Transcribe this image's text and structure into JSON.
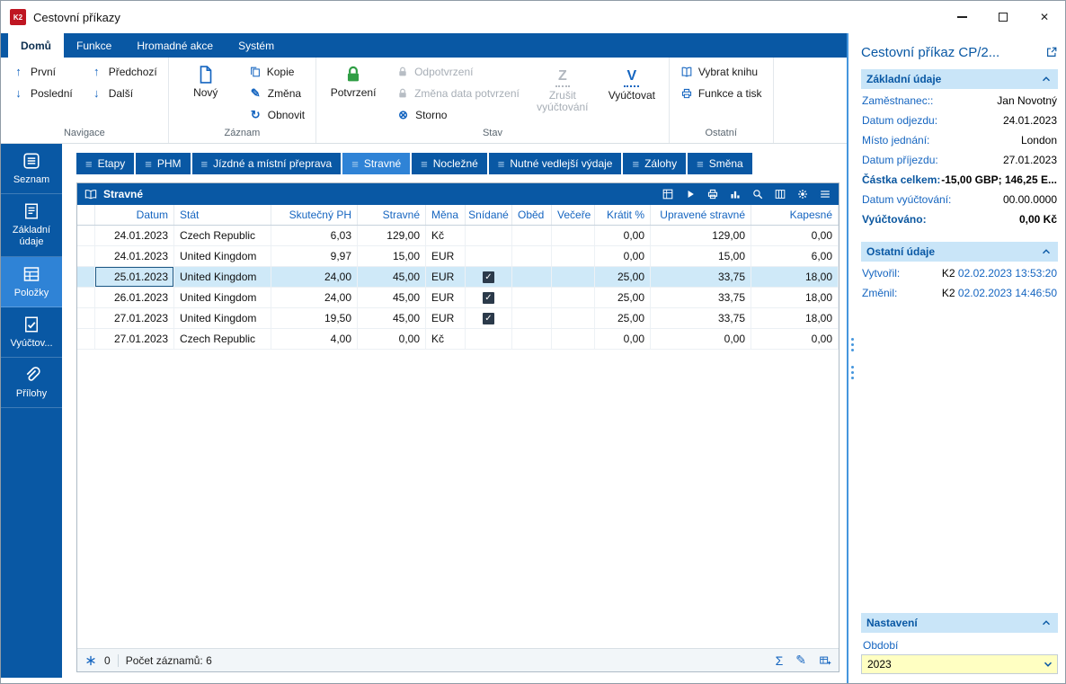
{
  "window": {
    "title": "Cestovní příkazy"
  },
  "colors": {
    "accent": "#0958a4",
    "accent_light": "#2f83d6",
    "selection": "#cfe9f8",
    "section_header_bg": "#c9e5f8",
    "combo_bg": "#ffffc2",
    "confirm_green": "#2f9e44",
    "label_blue": "#1565c0",
    "app_icon_red": "#bf1622"
  },
  "ribbon": {
    "tabs": [
      {
        "label": "Domů",
        "active": true
      },
      {
        "label": "Funkce",
        "active": false
      },
      {
        "label": "Hromadné akce",
        "active": false
      },
      {
        "label": "Systém",
        "active": false
      }
    ],
    "groups": [
      {
        "label": "Navigace"
      },
      {
        "label": "Záznam"
      },
      {
        "label": "Stav"
      },
      {
        "label": "Ostatní"
      }
    ],
    "buttons": {
      "prvni": "První",
      "posledni": "Poslední",
      "predchozi": "Předchozí",
      "dalsi": "Další",
      "novy": "Nový",
      "kopie": "Kopie",
      "zmena": "Změna",
      "obnovit": "Obnovit",
      "potvrzeni": "Potvrzení",
      "odpotvrzeni": "Odpotvrzení",
      "zmena_data_potvrzeni": "Změna data potvrzení",
      "storno": "Storno",
      "zrusit_vyuctovani": "Zrušit vyúčtování",
      "vyuctovat": "Vyúčtovat",
      "vybrat_knihu": "Vybrat knihu",
      "funkce_a_tisk": "Funkce a tisk"
    }
  },
  "sidebar": {
    "items": [
      {
        "label": "Seznam",
        "icon": "list-box-icon",
        "active": false
      },
      {
        "label": "Základní údaje",
        "icon": "form-icon",
        "active": false
      },
      {
        "label": "Položky",
        "icon": "items-grid-icon",
        "active": true
      },
      {
        "label": "Vyúčtov...",
        "icon": "receipt-check-icon",
        "active": false
      },
      {
        "label": "Přílohy",
        "icon": "paperclip-icon",
        "active": false
      }
    ]
  },
  "doc_tabs": {
    "items": [
      "Etapy",
      "PHM",
      "Jízdné a místní přeprava",
      "Stravné",
      "Nocležné",
      "Nutné vedlejší výdaje",
      "Zálohy",
      "Směna"
    ],
    "active": "Stravné"
  },
  "grid": {
    "title": "Stravné",
    "toolbar_icons": [
      "export-table-icon",
      "play-icon",
      "print-icon",
      "chart-icon",
      "search-icon",
      "columns-icon",
      "gear-icon",
      "menu-icon"
    ],
    "columns": [
      {
        "id": "rowsel",
        "label": "",
        "width": 20,
        "align": "left"
      },
      {
        "id": "datum",
        "label": "Datum",
        "width": 88,
        "align": "right"
      },
      {
        "id": "stat",
        "label": "Stát",
        "width": 108,
        "align": "left"
      },
      {
        "id": "skutecny_ph",
        "label": "Skutečný PH",
        "width": 96,
        "align": "right"
      },
      {
        "id": "stravne",
        "label": "Stravné",
        "width": 76,
        "align": "right"
      },
      {
        "id": "mena",
        "label": "Měna",
        "width": 44,
        "align": "left"
      },
      {
        "id": "snidane",
        "label": "Snídané",
        "width": 52,
        "align": "center",
        "type": "check"
      },
      {
        "id": "obed",
        "label": "Oběd",
        "width": 44,
        "align": "left"
      },
      {
        "id": "vecere",
        "label": "Večeře",
        "width": 48,
        "align": "left"
      },
      {
        "id": "kratit",
        "label": "Krátit %",
        "width": 62,
        "align": "right"
      },
      {
        "id": "upravene_stravne",
        "label": "Upravené stravné",
        "width": 112,
        "align": "right"
      },
      {
        "id": "kapesne",
        "label": "Kapesné",
        "width": 80,
        "align": "right",
        "flex": true
      }
    ],
    "rows": [
      {
        "datum": "24.01.2023",
        "stat": "Czech Republic",
        "skutecny_ph": "6,03",
        "stravne": "129,00",
        "mena": "Kč",
        "snidane": false,
        "obed": "",
        "vecere": "",
        "kratit": "0,00",
        "upravene_stravne": "129,00",
        "kapesne": "0,00"
      },
      {
        "datum": "24.01.2023",
        "stat": "United Kingdom",
        "skutecny_ph": "9,97",
        "stravne": "15,00",
        "mena": "EUR",
        "snidane": false,
        "obed": "",
        "vecere": "",
        "kratit": "0,00",
        "upravene_stravne": "15,00",
        "kapesne": "6,00"
      },
      {
        "datum": "25.01.2023",
        "stat": "United Kingdom",
        "skutecny_ph": "24,00",
        "stravne": "45,00",
        "mena": "EUR",
        "snidane": true,
        "obed": "",
        "vecere": "",
        "kratit": "25,00",
        "upravene_stravne": "33,75",
        "kapesne": "18,00"
      },
      {
        "datum": "26.01.2023",
        "stat": "United Kingdom",
        "skutecny_ph": "24,00",
        "stravne": "45,00",
        "mena": "EUR",
        "snidane": true,
        "obed": "",
        "vecere": "",
        "kratit": "25,00",
        "upravene_stravne": "33,75",
        "kapesne": "18,00"
      },
      {
        "datum": "27.01.2023",
        "stat": "United Kingdom",
        "skutecny_ph": "19,50",
        "stravne": "45,00",
        "mena": "EUR",
        "snidane": true,
        "obed": "",
        "vecere": "",
        "kratit": "25,00",
        "upravene_stravne": "33,75",
        "kapesne": "18,00"
      },
      {
        "datum": "27.01.2023",
        "stat": "Czech Republic",
        "skutecny_ph": "4,00",
        "stravne": "0,00",
        "mena": "Kč",
        "snidane": false,
        "obed": "",
        "vecere": "",
        "kratit": "0,00",
        "upravene_stravne": "0,00",
        "kapesne": "0,00"
      }
    ],
    "selected_row": 2,
    "footer": {
      "counter_value": "0",
      "records_label": "Počet záznamů: 6",
      "icons": [
        "sum-icon",
        "edit-icon",
        "add-table-icon"
      ]
    }
  },
  "panel": {
    "title": "Cestovní příkaz CP/2...",
    "sections": {
      "zakladni_udaje": {
        "header": "Základní údaje",
        "fields": [
          {
            "label": "Zaměstnanec::",
            "value": "Jan Novotný"
          },
          {
            "label": "Datum odjezdu:",
            "value": "24.01.2023"
          },
          {
            "label": "Místo jednání:",
            "value": "London"
          },
          {
            "label": "Datum příjezdu:",
            "value": "27.01.2023"
          },
          {
            "label": "Částka celkem:",
            "value": "-15,00 GBP; 146,25 E...",
            "bold": true
          },
          {
            "label": "Datum vyúčtování:",
            "value": "00.00.0000"
          },
          {
            "label": "Vyúčtováno:",
            "value": "0,00 Kč",
            "bold": true
          }
        ]
      },
      "ostatni_udaje": {
        "header": "Ostatní údaje",
        "fields": [
          {
            "label": "Vytvořil:",
            "user": "K2",
            "time": "02.02.2023 13:53:20"
          },
          {
            "label": "Změnil:",
            "user": "K2",
            "time": "02.02.2023 14:46:50"
          }
        ]
      },
      "nastaveni": {
        "header": "Nastavení",
        "obdobi_label": "Období",
        "obdobi_value": "2023"
      }
    }
  }
}
